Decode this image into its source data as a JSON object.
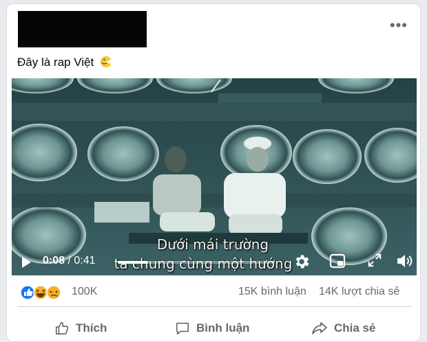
{
  "post": {
    "caption": "Đây là rap Việt"
  },
  "video": {
    "subtitle_line1": "Dưới mái trường",
    "subtitle_line2": "ta chung cùng một hướng",
    "current_time": "0:08",
    "time_separator": " / ",
    "duration": "0:41",
    "progress_fraction": 0.195
  },
  "reactions": {
    "types": [
      "like",
      "haha",
      "sad"
    ],
    "count": "100K"
  },
  "counts": {
    "comments": "15K bình luận",
    "shares": "14K lượt chia sẻ"
  },
  "actions": {
    "like_label": "Thích",
    "comment_label": "Bình luận",
    "share_label": "Chia sẻ"
  },
  "colors": {
    "like_blue": "#1877f2",
    "reaction_yellow": "#f7b125",
    "secondary_text": "#65676b"
  }
}
